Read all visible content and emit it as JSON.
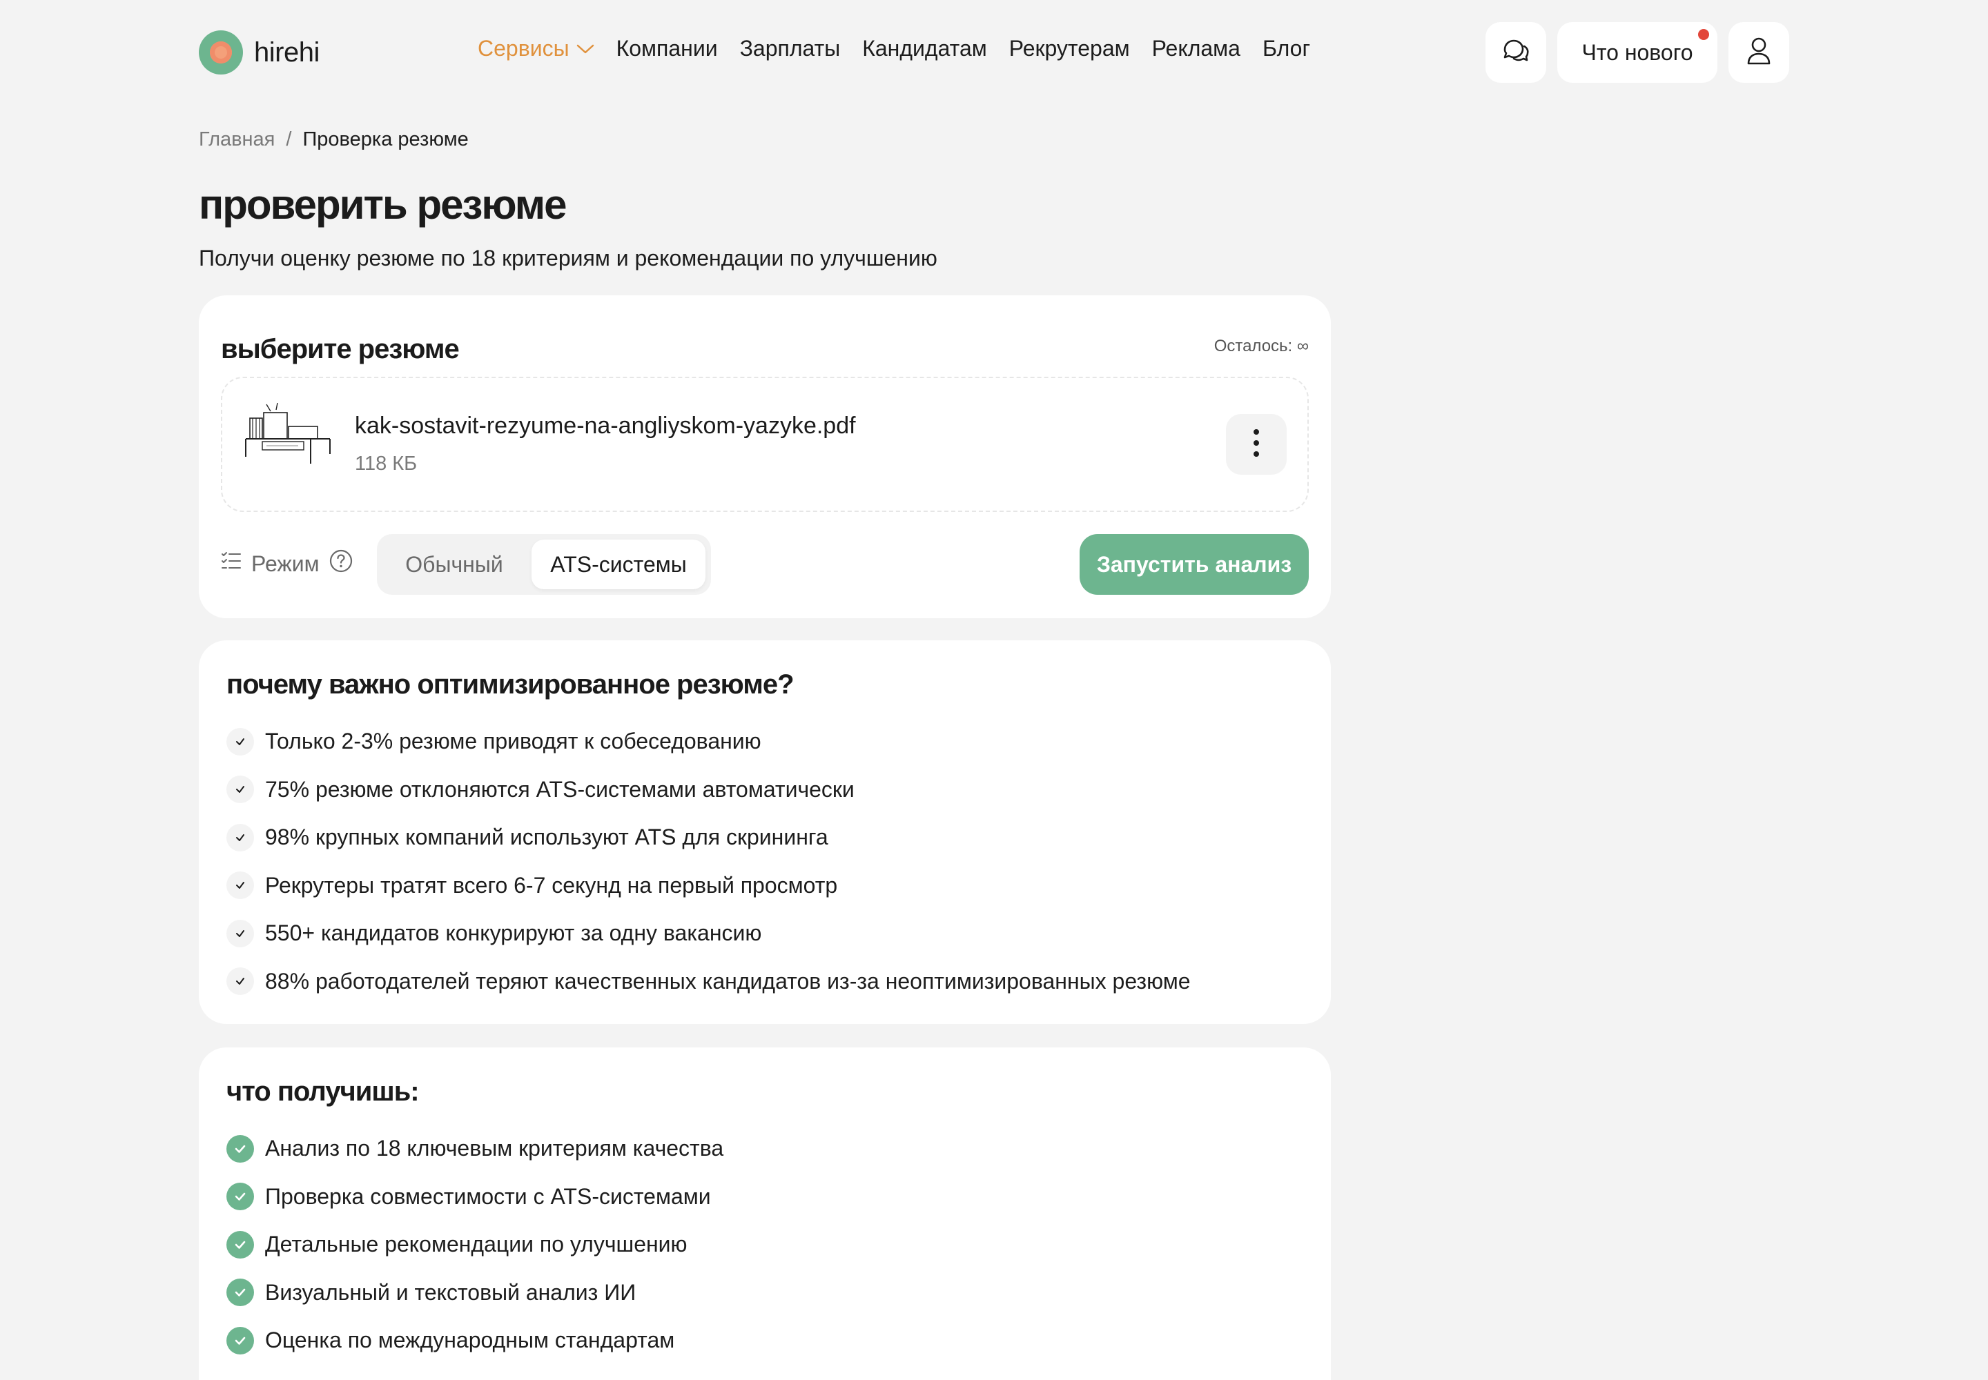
{
  "header": {
    "logo_text": "hirehi",
    "nav": {
      "services": "Сервисы",
      "companies": "Компании",
      "salaries": "Зарплаты",
      "candidates": "Кандидатам",
      "recruiters": "Рекрутерам",
      "ads": "Реклама",
      "blog": "Блог"
    },
    "whats_new": "Что нового",
    "accent_color": "#e0913c",
    "notification_color": "#e2463a"
  },
  "breadcrumb": {
    "home": "Главная",
    "separator": "/",
    "current": "Проверка резюме"
  },
  "page": {
    "title": "проверить резюме",
    "subtitle": "Получи оценку резюме по 18 критериям и рекомендации по улучшению"
  },
  "select_card": {
    "title": "выберите резюме",
    "remaining": "Осталось: ∞",
    "file": {
      "name": "kak-sostavit-rezyume-na-angliyskom-yazyke.pdf",
      "size": "118 КБ"
    },
    "mode_label": "Режим",
    "modes": {
      "normal": "Обычный",
      "ats": "ATS-системы",
      "selected": "ATS-системы"
    },
    "run_button": "Запустить анализ",
    "brand_color": "#6db58f"
  },
  "why_card": {
    "title": "почему важно оптимизированное резюме?",
    "items": [
      "Только 2-3% резюме приводят к собеседованию",
      "75% резюме отклоняются ATS-системами автоматически",
      "98% крупных компаний используют ATS для скрининга",
      "Рекрутеры тратят всего 6-7 секунд на первый просмотр",
      "550+ кандидатов конкурируют за одну вакансию",
      "88% работодателей теряют качественных кандидатов из-за неоптимизированных резюме"
    ]
  },
  "get_card": {
    "title": "что получишь:",
    "items": [
      "Анализ по 18 ключевым критериям качества",
      "Проверка совместимости с ATS-системами",
      "Детальные рекомендации по улучшению",
      "Визуальный и текстовый анализ ИИ",
      "Оценка по международным стандартам"
    ]
  }
}
